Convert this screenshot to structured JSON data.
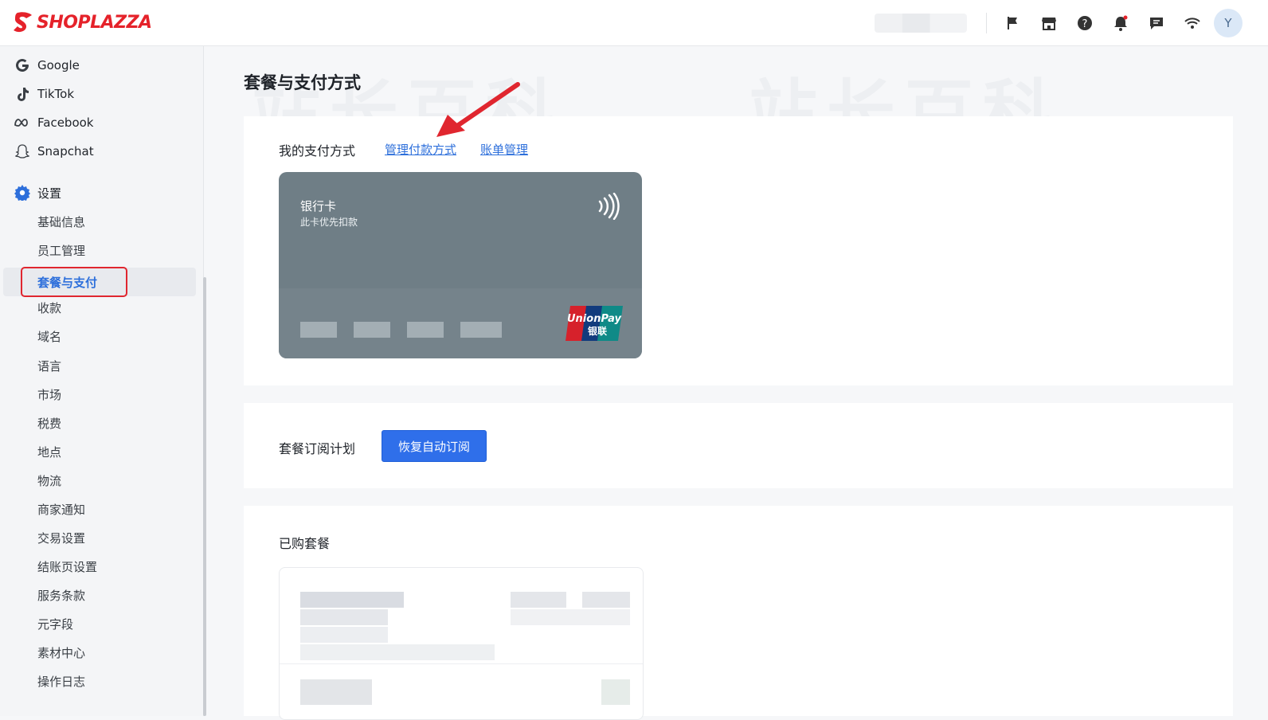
{
  "app": {
    "brand": "SHOPLAZZA",
    "avatar_initial": "Y"
  },
  "topbar": {
    "icons": [
      "flag-icon",
      "store-icon",
      "help-icon",
      "bell-icon",
      "chat-icon",
      "wifi-icon"
    ]
  },
  "sidebar": {
    "channels": [
      {
        "label": "Google",
        "icon": "google-icon"
      },
      {
        "label": "TikTok",
        "icon": "tiktok-icon"
      },
      {
        "label": "Facebook",
        "icon": "meta-icon"
      },
      {
        "label": "Snapchat",
        "icon": "snapchat-icon"
      }
    ],
    "settings_label": "设置",
    "settings_items": [
      "基础信息",
      "员工管理",
      "套餐与支付",
      "收款",
      "域名",
      "语言",
      "市场",
      "税费",
      "地点",
      "物流",
      "商家通知",
      "交易设置",
      "结账页设置",
      "服务条款",
      "元字段",
      "素材中心",
      "操作日志"
    ],
    "active_item": "套餐与支付"
  },
  "page": {
    "title": "套餐与支付方式",
    "payment": {
      "label": "我的支付方式",
      "manage_link": "管理付款方式",
      "bill_link": "账单管理",
      "card": {
        "type": "银行卡",
        "note": "此卡优先扣款",
        "network": "UnionPay",
        "network_cn": "银联"
      }
    },
    "subscription": {
      "label": "套餐订阅计划",
      "button": "恢复自动订阅"
    },
    "purchased": {
      "label": "已购套餐"
    }
  },
  "watermark": "站长百科",
  "colors": {
    "accent": "#2f6fea",
    "brand": "#e5222a",
    "highlight": "#e0262f"
  }
}
